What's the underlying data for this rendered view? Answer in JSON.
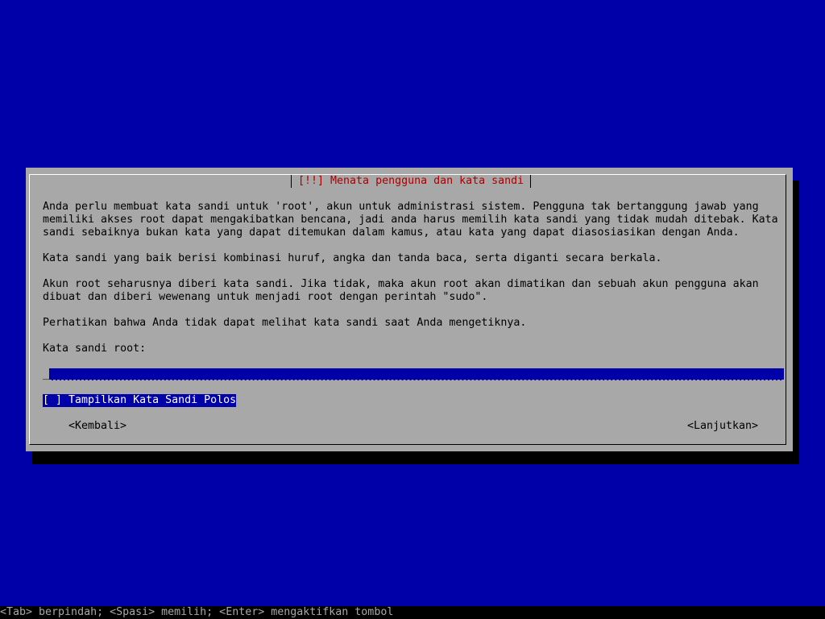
{
  "dialog": {
    "title": "[!!] Menata pengguna dan kata sandi",
    "paragraphs": [
      "Anda perlu membuat kata sandi untuk 'root', akun untuk administrasi sistem. Pengguna tak bertanggung jawab yang\nmemiliki akses root dapat mengakibatkan bencana, jadi anda harus memilih kata sandi yang tidak mudah ditebak. Kata\nsandi sebaiknya bukan kata yang dapat ditemukan dalam kamus, atau kata yang dapat diasosiasikan dengan Anda.",
      "Kata sandi yang baik berisi kombinasi huruf, angka dan tanda baca, serta diganti secara berkala.",
      "Akun root seharusnya diberi kata sandi. Jika tidak, maka akun root akan dimatikan dan sebuah akun pengguna akan\ndibuat dan diberi wewenang untuk menjadi root dengan perintah \"sudo\".",
      "Perhatikan bahwa Anda tidak dapat melihat kata sandi saat Anda mengetiknya."
    ],
    "field_label": "Kata sandi root:",
    "password_value": "",
    "cursor": "_",
    "checkbox_label": "[ ] Tampilkan Kata Sandi Polos",
    "back_button": "<Kembali>",
    "continue_button": "<Lanjutkan>"
  },
  "help_bar": "<Tab> berpindah; <Spasi> memilih; <Enter> mengaktifkan tombol",
  "colors": {
    "background": "#0000a8",
    "dialog": "#a8a8a8",
    "title": "#a80000",
    "highlight": "#0000a8"
  }
}
